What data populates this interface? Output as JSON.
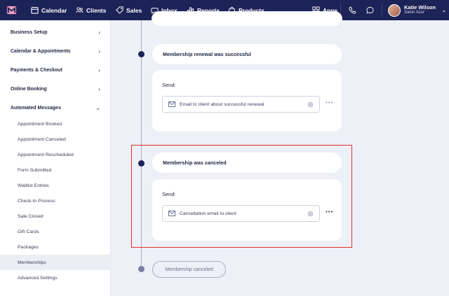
{
  "nav": {
    "items": [
      {
        "label": "Calendar",
        "icon": "calendar-icon"
      },
      {
        "label": "Clients",
        "icon": "clients-icon"
      },
      {
        "label": "Sales",
        "icon": "tag-icon"
      },
      {
        "label": "Inbox",
        "icon": "inbox-icon"
      },
      {
        "label": "Reports",
        "icon": "bar-chart-icon"
      },
      {
        "label": "Products",
        "icon": "bag-icon"
      }
    ],
    "apps_label": "Apps",
    "user": {
      "name": "Katie Wilson",
      "salon": "Salon Azul"
    }
  },
  "sidebar": {
    "top_items": [
      {
        "label": "Business Setup"
      },
      {
        "label": "Calendar & Appointments"
      },
      {
        "label": "Payments & Checkout"
      },
      {
        "label": "Online Booking"
      },
      {
        "label": "Automated Messages"
      }
    ],
    "sub_items": [
      {
        "label": "Appointment Booked"
      },
      {
        "label": "Appointment Canceled"
      },
      {
        "label": "Appointment Rescheduled"
      },
      {
        "label": "Form Submitted"
      },
      {
        "label": "Waitlist Entries"
      },
      {
        "label": "Check-In Process"
      },
      {
        "label": "Sale Closed"
      },
      {
        "label": "Gift Cards"
      },
      {
        "label": "Packages"
      },
      {
        "label": "Memberships"
      },
      {
        "label": "Advanced Settings"
      }
    ]
  },
  "timeline": {
    "events": [
      {
        "title": "Membership renewal was successful",
        "send_label": "Send:",
        "message": "Email to client about successful renewal"
      },
      {
        "title": "Membership was canceled",
        "send_label": "Send:",
        "message": "Cancellation email to client"
      }
    ],
    "end_label": "Membership canceled"
  },
  "colors": {
    "nav_bg": "#1c2357",
    "highlight": "#e0332a",
    "page_bg": "#eef0f7"
  }
}
